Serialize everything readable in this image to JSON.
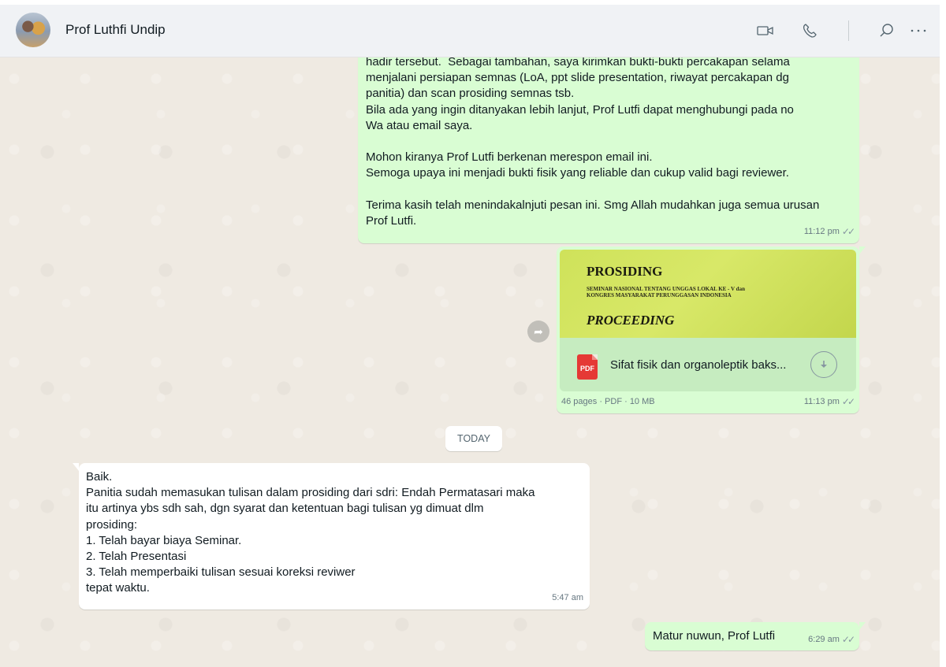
{
  "header": {
    "contact_name": "Prof Luthfi Undip",
    "icons": [
      "video-call-icon",
      "voice-call-icon",
      "search-icon",
      "more-options-icon"
    ]
  },
  "messages": {
    "m1": {
      "text": "hadir tersebut.  Sebagai tambahan, saya kirimkan bukti-bukti percakapan selama\nmenjalani persiapan semnas (LoA, ppt slide presentation, riwayat percakapan dg\npanitia) dan scan prosiding semnas tsb.\nBila ada yang ingin ditanyakan lebih lanjut, Prof Lutfi dapat menghubungi pada no\nWa atau email saya.\n\nMohon kiranya Prof Lutfi berkenan merespon email ini.\nSemoga upaya ini menjadi bukti fisik yang reliable dan cukup valid bagi reviewer.\n\nTerima kasih telah menindakalnjuti pesan ini. Smg Allah mudahkan juga semua urusan\nProf Lutfi.",
      "time": "11:12 pm"
    },
    "m2": {
      "preview_title_1": "PROSIDING",
      "preview_sub": "SEMINAR NASIONAL TENTANG UNGGAS LOKAL KE - V  dan\nKONGRES MASYARAKAT PERUNGGASAN INDONESIA",
      "preview_title_2": "PROCEEDING",
      "file_icon_label": "PDF",
      "file_name": "Sifat fisik dan organoleptik baks...",
      "file_info": "46 pages · PDF · 10 MB",
      "time": "11:13 pm"
    },
    "date_divider": "TODAY",
    "m3": {
      "text": "Baik.\nPanitia sudah memasukan tulisan dalam prosiding dari sdri: Endah Permatasari maka\nitu artinya ybs sdh sah, dgn syarat dan ketentuan bagi tulisan yg dimuat dlm\nprosiding:\n1. Telah bayar biaya Seminar.\n2. Telah Presentasi\n3. Telah memperbaiki tulisan sesuai koreksi reviwer\ntepat waktu.",
      "time": "5:47 am"
    },
    "m4": {
      "text": "Matur nuwun, Prof Lutfi",
      "time": "6:29 am"
    }
  },
  "colors": {
    "outgoing_bubble": "#d9fdd3",
    "incoming_bubble": "#ffffff",
    "chat_background": "#efeae2",
    "header_background": "#f0f2f5"
  }
}
